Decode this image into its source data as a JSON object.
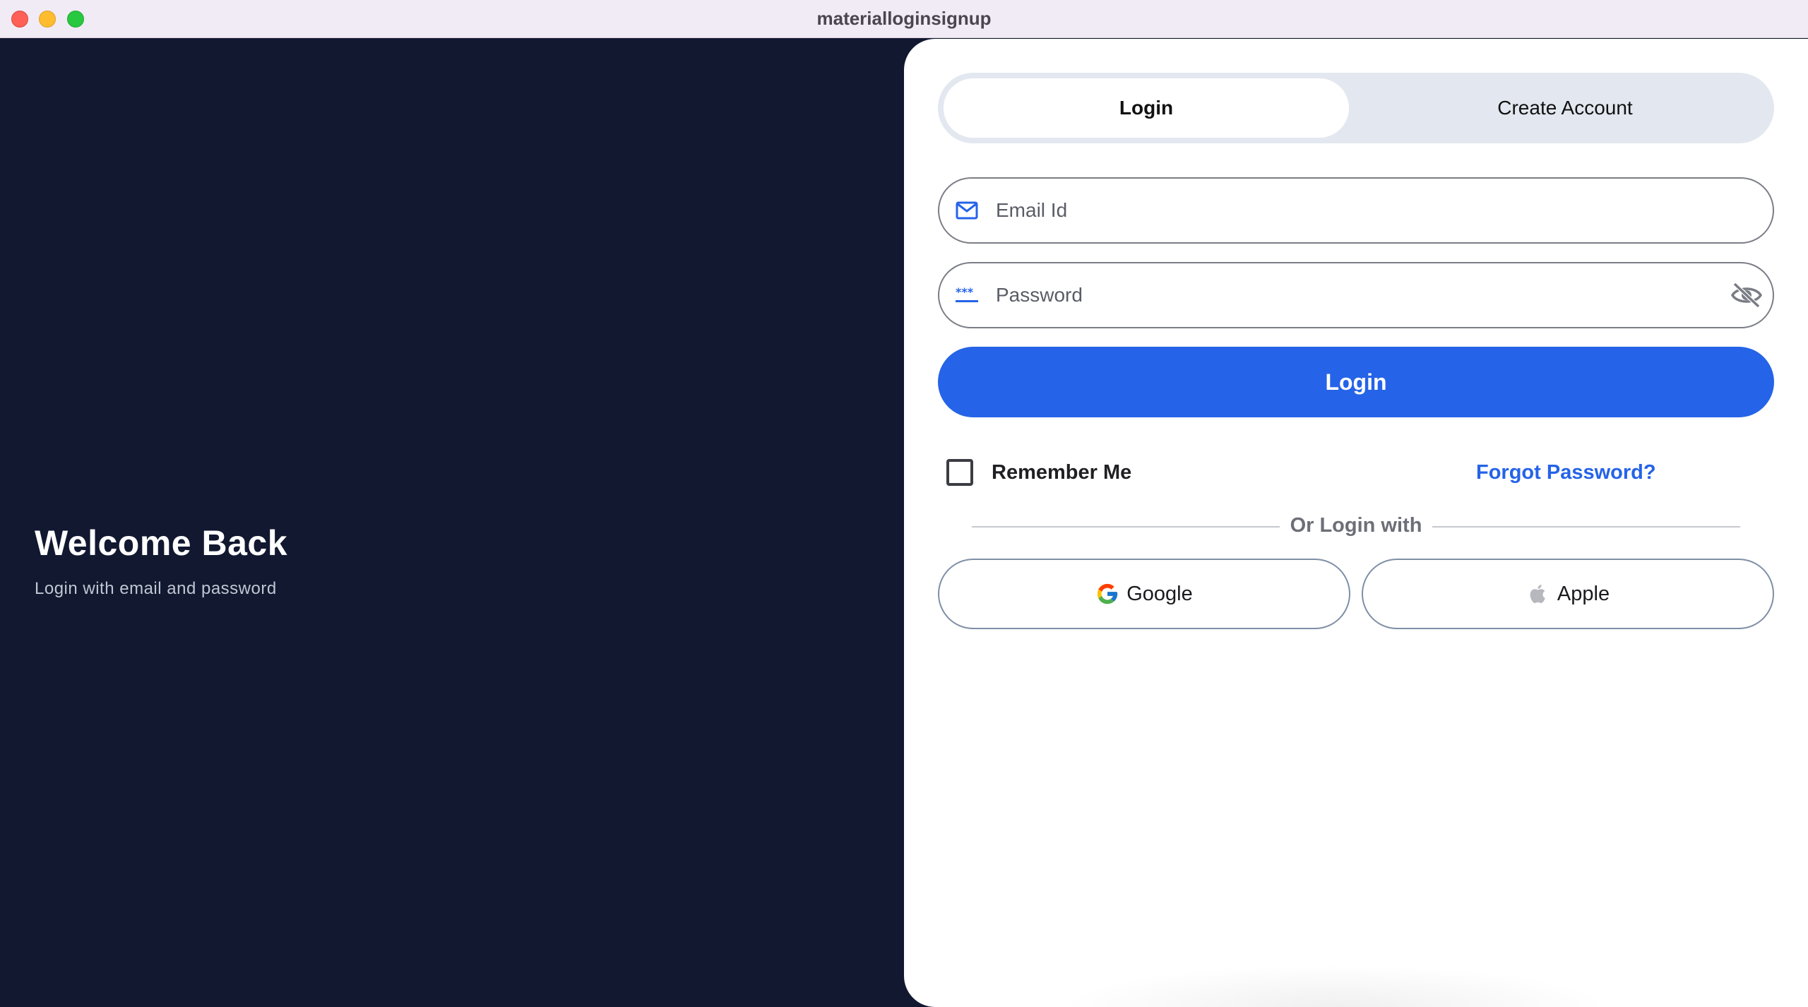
{
  "window": {
    "title": "materialloginsignup"
  },
  "left_panel": {
    "heading": "Welcome Back",
    "subheading": "Login with email and password"
  },
  "tabs": [
    {
      "label": "Login",
      "active": true
    },
    {
      "label": "Create Account",
      "active": false
    }
  ],
  "form": {
    "email": {
      "placeholder": "Email Id",
      "value": "",
      "icon": "mail-icon"
    },
    "password": {
      "placeholder": "Password",
      "value": "",
      "icon": "password-dots-icon",
      "toggle_icon": "eye-off-icon"
    },
    "login_button": "Login",
    "remember_label": "Remember Me",
    "remember_checked": false,
    "forgot_link": "Forgot Password?",
    "divider_text": "Or Login with"
  },
  "social": {
    "google_label": "Google",
    "apple_label": "Apple"
  },
  "colors": {
    "primary": "#2563e8",
    "dark_panel": "#111830",
    "tab_track": "#e3e8f0"
  }
}
